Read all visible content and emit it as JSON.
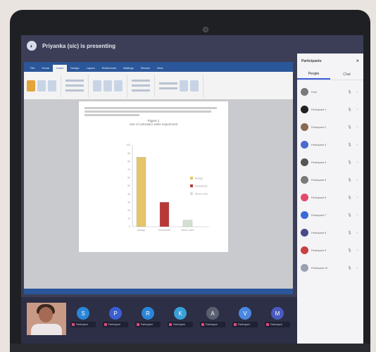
{
  "meeting": {
    "title": "Priyanka (sic) is presenting"
  },
  "document": {
    "tabs": [
      "File",
      "Home",
      "Insert",
      "Design",
      "Layout",
      "References",
      "Mailings",
      "Review",
      "View"
    ],
    "active_tab": "Insert",
    "figure_title": "Figure 1",
    "figure_subtitle": "Use of calculator while experiment"
  },
  "chart_data": {
    "type": "bar",
    "categories": [
      "Always",
      "Sometimes",
      "Never used"
    ],
    "values": [
      85,
      30,
      8
    ],
    "series_colors": [
      "#e5c46a",
      "#b83838",
      "#d6e0d2"
    ],
    "ylim": [
      0,
      100
    ],
    "yticks": [
      0,
      10,
      20,
      30,
      40,
      50,
      60,
      70,
      80,
      90,
      100
    ],
    "grid": false
  },
  "panel": {
    "title": "Participants",
    "tabs": [
      "People",
      "Chat"
    ],
    "active_tab": "People",
    "participants": [
      {
        "name": "Host",
        "color": "#7a7a7a"
      },
      {
        "name": "Participant 1",
        "color": "#222222"
      },
      {
        "name": "Participant 2",
        "color": "#8a6a50"
      },
      {
        "name": "Participant 3",
        "color": "#4a6ad0"
      },
      {
        "name": "Participant 4",
        "color": "#555555"
      },
      {
        "name": "Participant 5",
        "color": "#7a7a7a"
      },
      {
        "name": "Participant 6",
        "color": "#e24a6a"
      },
      {
        "name": "Participant 7",
        "color": "#3a6ad8"
      },
      {
        "name": "Participant 8",
        "color": "#4a4a8a"
      },
      {
        "name": "Participant 9",
        "color": "#c84040"
      },
      {
        "name": "Participant 10",
        "color": "#9aa0b0"
      }
    ]
  },
  "strip": {
    "tiles": [
      {
        "initial": "S",
        "color": "#2a86d8",
        "name": "Participant"
      },
      {
        "initial": "P",
        "color": "#3a5fd0",
        "name": "Participant"
      },
      {
        "initial": "R",
        "color": "#2a86d8",
        "name": "Participant"
      },
      {
        "initial": "K",
        "color": "#3a9fd8",
        "name": "Participant"
      },
      {
        "initial": "A",
        "color": "#5a6070",
        "name": "Participant"
      },
      {
        "initial": "V",
        "color": "#4a88e0",
        "name": "Participant"
      },
      {
        "initial": "M",
        "color": "#4a5ac0",
        "name": "Participant"
      }
    ]
  }
}
